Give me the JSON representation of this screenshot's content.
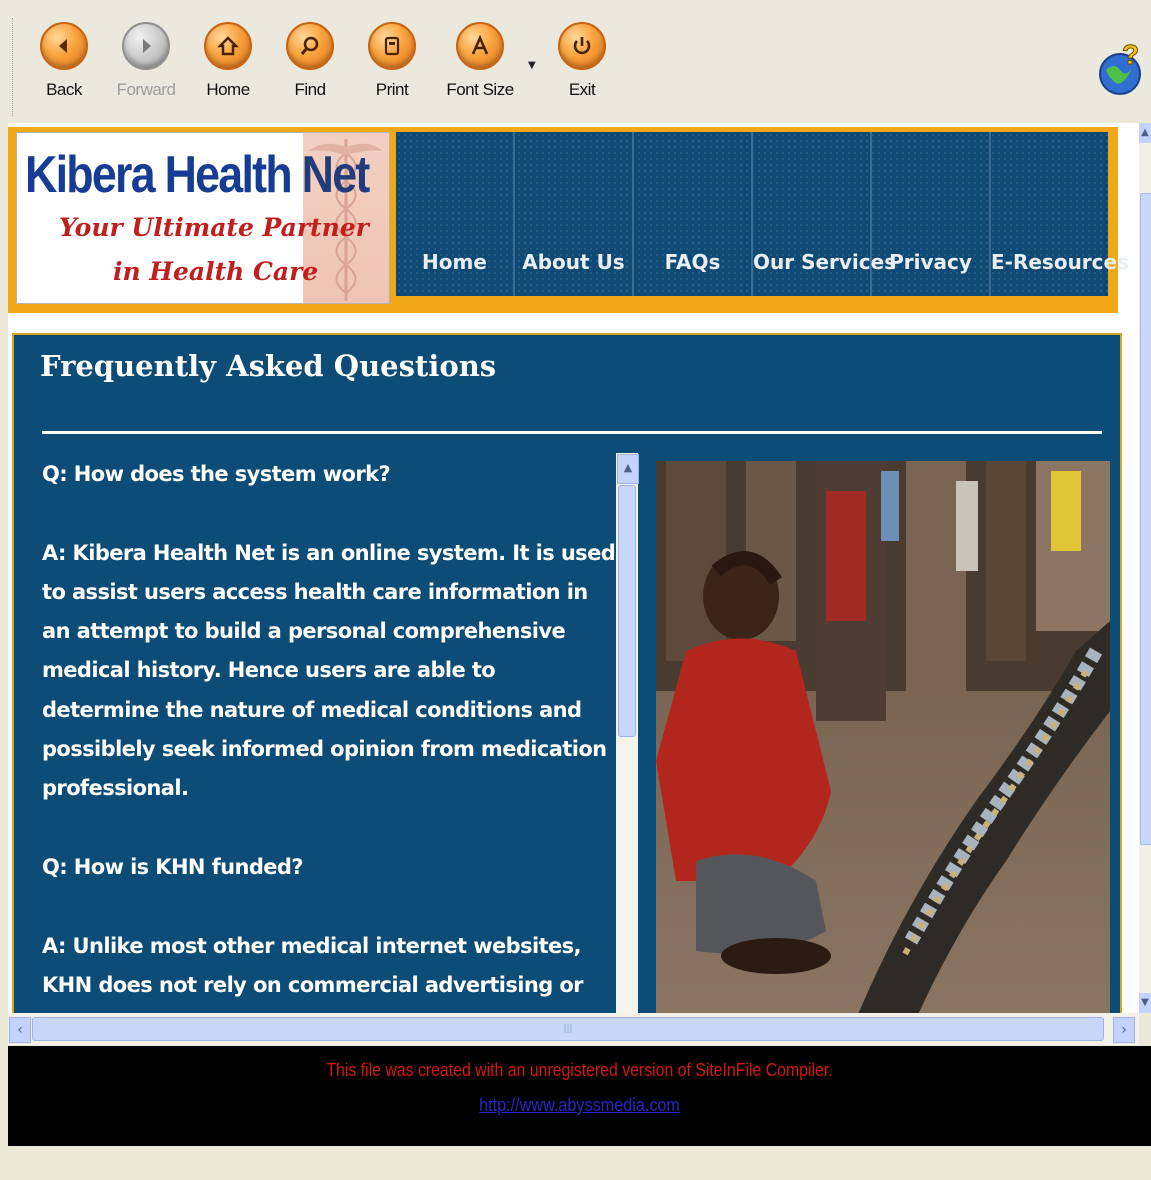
{
  "toolbar": {
    "buttons": [
      {
        "label": "Back",
        "icon": "arrow-left-icon",
        "enabled": true
      },
      {
        "label": "Forward",
        "icon": "arrow-right-icon",
        "enabled": false
      },
      {
        "label": "Home",
        "icon": "house-icon",
        "enabled": true
      },
      {
        "label": "Find",
        "icon": "magnifier-icon",
        "enabled": true
      },
      {
        "label": "Print",
        "icon": "printer-icon",
        "enabled": true
      },
      {
        "label": "Font Size",
        "icon": "letter-a-icon",
        "enabled": true
      },
      {
        "label": "Exit",
        "icon": "exit-arrow-icon",
        "enabled": true
      }
    ],
    "accent": "#f8a23c"
  },
  "header": {
    "logo_title": "Kibera Health",
    "logo_title_end": "Net",
    "tagline_line1": "Your Ultimate Partner",
    "tagline_line2": "in Health Care",
    "nav": [
      "Home",
      "About Us",
      "FAQs",
      "Our Services",
      "Privacy",
      "E-Resources"
    ]
  },
  "faq": {
    "title": "Frequently Asked Questions",
    "q1": "Q: How does the system work?",
    "a1": "A: Kibera Health Net is an online system. It is used to assist users access health care information in an attempt to build a personal comprehensive medical history. Hence users are able to determine the nature of medical conditions and possiblely seek informed opinion from medication professional.",
    "q2": "Q: How is KHN funded?",
    "a2": "A: Unlike most other medical internet websites, KHN does not rely on commercial advertising or sponsorship for support. It is intended to be a free health care information and resource center..."
  },
  "footer": {
    "notice": "This file was created with an unregistered version of SiteInFile Compiler.",
    "link": "http://www.abyssmedia.com"
  },
  "colors": {
    "panel": "#0c4c76",
    "header_border": "#f0a818",
    "logo_blue": "#163d93",
    "logo_red": "#c21e1e"
  }
}
